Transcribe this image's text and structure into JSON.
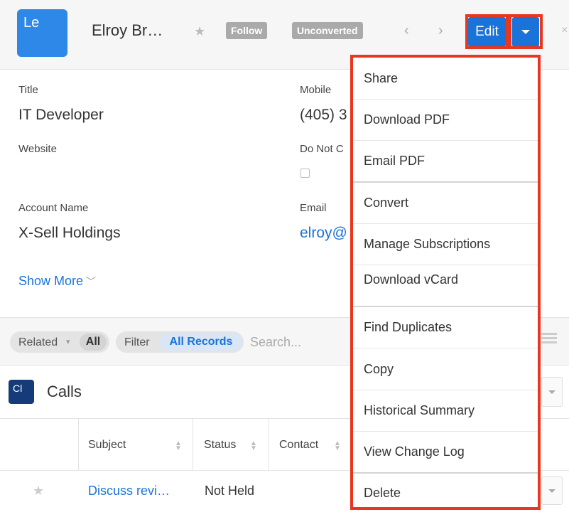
{
  "header": {
    "module_abbrev": "Le",
    "record_name": "Elroy Br…",
    "follow_label": "Follow",
    "status_label": "Unconverted",
    "edit_label": "Edit"
  },
  "fields": {
    "title_label": "Title",
    "title_value": "IT Developer",
    "mobile_label": "Mobile",
    "mobile_value": "(405) 3",
    "website_label": "Website",
    "do_not_call_label": "Do Not C",
    "account_label": "Account Name",
    "account_value": "X-Sell Holdings",
    "email_label": "Email",
    "email_value": "elroy@",
    "show_more": "Show More"
  },
  "toolbar": {
    "related_label": "Related",
    "related_selected": "All",
    "filter_label": "Filter",
    "filter_selected": "All Records",
    "search_placeholder": "Search..."
  },
  "subpanel": {
    "module_abbrev": "Cl",
    "title": "Calls",
    "columns": [
      "Subject",
      "Status",
      "Contact"
    ],
    "rows": [
      {
        "subject": "Discuss revi…",
        "status": "Not Held"
      }
    ]
  },
  "menu": {
    "items": [
      "Share",
      "Download PDF",
      "Email PDF",
      "Convert",
      "Manage Subscriptions",
      "Download vCard",
      "Find Duplicates",
      "Copy",
      "Historical Summary",
      "View Change Log",
      "Delete"
    ]
  },
  "colors": {
    "primary": "#1a73d8",
    "highlight": "#e8371e",
    "module_lead": "#2e88e8",
    "module_calls": "#163b7a"
  }
}
